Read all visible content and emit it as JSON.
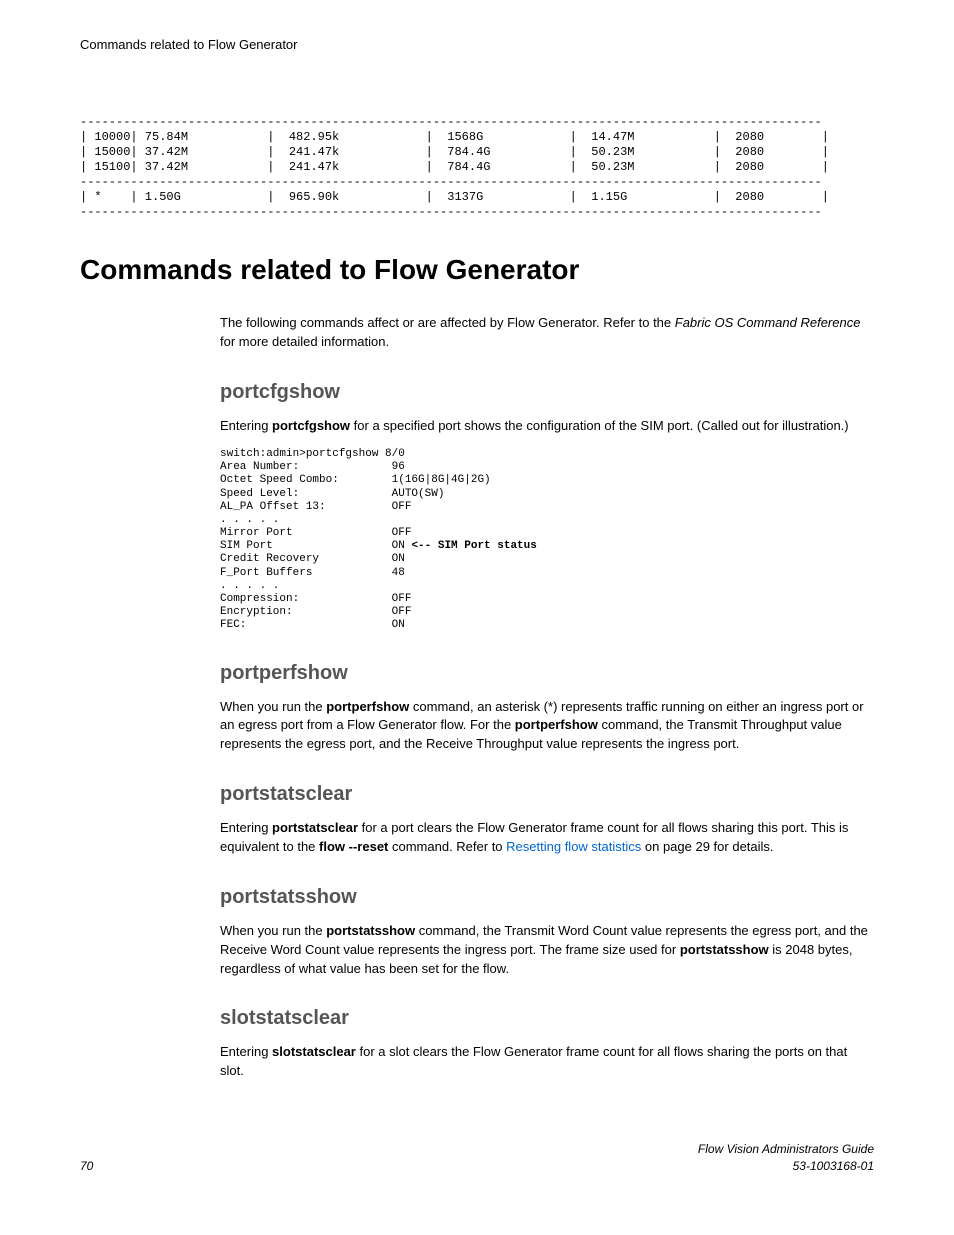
{
  "running_head": "Commands related to Flow Generator",
  "table_block": "-------------------------------------------------------------------------------------------------------\n| 10000| 75.84M           |  482.95k            |  1568G            |  14.47M           |  2080        |\n| 15000| 37.42M           |  241.47k            |  784.4G           |  50.23M           |  2080        |\n| 15100| 37.42M           |  241.47k            |  784.4G           |  50.23M           |  2080        |\n-------------------------------------------------------------------------------------------------------\n| *    | 1.50G            |  965.90k            |  3137G            |  1.15G            |  2080        |\n-------------------------------------------------------------------------------------------------------",
  "h1": "Commands related to Flow Generator",
  "intro": {
    "pre": "The following commands affect or are affected by Flow Generator. Refer to the ",
    "em": "Fabric OS Command Reference",
    "post": " for more detailed information."
  },
  "portcfgshow": {
    "heading": "portcfgshow",
    "p_pre": "Entering ",
    "p_bold": "portcfgshow",
    "p_post": " for a specified port shows the configuration of the SIM port. (Called out for illustration.)",
    "code_pre": "switch:admin>portcfgshow 8/0\nArea Number:              96\nOctet Speed Combo:        1(16G|8G|4G|2G)\nSpeed Level:              AUTO(SW)\nAL_PA Offset 13:          OFF\n. . . . .\nMirror Port               OFF\nSIM Port                  ON ",
    "code_bold": "<-- SIM Port status",
    "code_post": "\nCredit Recovery           ON\nF_Port Buffers            48\n. . . . .\nCompression:              OFF\nEncryption:               OFF\nFEC:                      ON"
  },
  "portperfshow": {
    "heading": "portperfshow",
    "pre": "When you run the ",
    "b1": "portperfshow",
    "mid": " command, an asterisk (*) represents traffic running on either an ingress port or an egress port from a Flow Generator flow. For the ",
    "b2": "portperfshow",
    "post": " command, the Transmit Throughput value represents the egress port, and the Receive Throughput value represents the ingress port."
  },
  "portstatsclear": {
    "heading": "portstatsclear",
    "pre": "Entering ",
    "b1": "portstatsclear",
    "mid": " for a port clears the Flow Generator frame count for all flows sharing this port. This is equivalent to the ",
    "b2": "flow --reset",
    "mid2": " command. Refer to ",
    "link": "Resetting flow statistics",
    "post": " on page 29 for details."
  },
  "portstatsshow": {
    "heading": "portstatsshow",
    "pre": "When you run the ",
    "b1": "portstatsshow",
    "mid": " command, the Transmit Word Count value represents the egress port, and the Receive Word Count value represents the ingress port. The frame size used for ",
    "b2": "portstatsshow",
    "post": " is 2048 bytes, regardless of what value has been set for the flow."
  },
  "slotstatsclear": {
    "heading": "slotstatsclear",
    "pre": "Entering ",
    "b1": "slotstatsclear",
    "post": " for a slot clears the Flow Generator frame count for all flows sharing the ports on that slot."
  },
  "footer": {
    "page": "70",
    "title": "Flow Vision Administrators Guide",
    "docnum": "53-1003168-01"
  }
}
